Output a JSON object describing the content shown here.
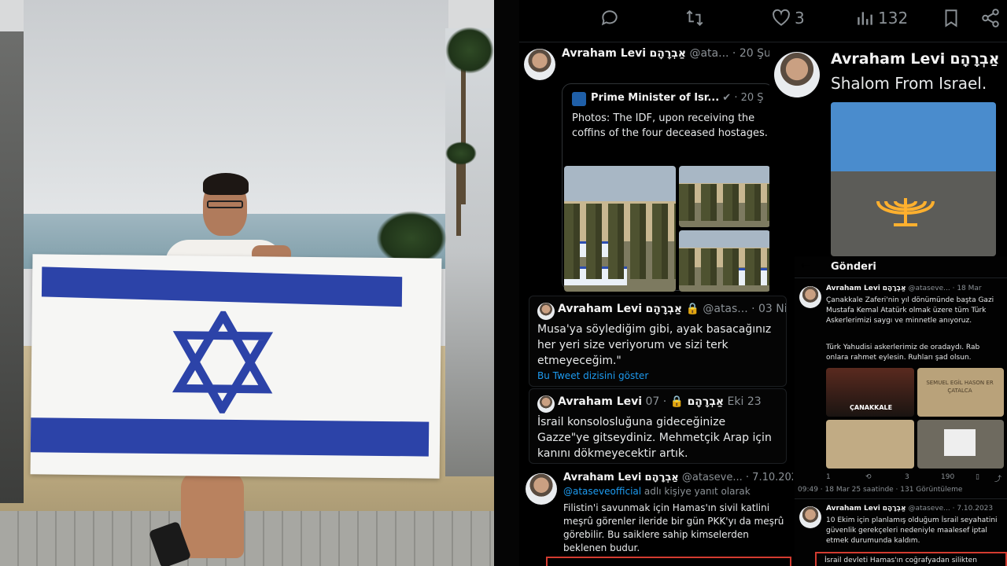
{
  "actions": {
    "replies": "",
    "retweets": "",
    "likes": "3",
    "views": "132"
  },
  "left_tweet": {
    "name": "Avraham Levi",
    "hebrew": "אַבְרָהָם",
    "handle": "@ata...",
    "date": "· 20 Şu",
    "emoji": "😔😔",
    "quote": {
      "name": "Prime Minister of Isr...",
      "date": "· 20 Ş",
      "text": "Photos: The IDF, upon receiving the coffins of the four deceased hostages."
    }
  },
  "right_top": {
    "name": "Avraham Levi",
    "hebrew": "אַבְרָהָם",
    "text": "Shalom From Israel."
  },
  "tweet2": {
    "name": "Avraham Levi",
    "hebrew": "אַבְרָהָם",
    "handle": "@atas...",
    "date": "· 03 Nis",
    "text": "Musa'ya söylediğim gibi, ayak basacağınız her yeri size veriyorum ve sizi terk etmeyeceğim.\"",
    "link": "Bu Tweet dizisini göster"
  },
  "tweet3": {
    "name": "Avraham Levi",
    "hebrew": "אַבְרָהָם",
    "date": "· 07 Eki 23",
    "text": "İsrail konsolosluğuna gideceğinize Gazze\"ye gitseydiniz. Mehmetçik Arap için kanını dökmeyecektir artık."
  },
  "tweet4": {
    "name": "Avraham Levi",
    "hebrew": "אַבְרָהָם",
    "handle": "@ataseve...",
    "date": "· 7.10.2023",
    "reply_handle": "@ataseveofficial",
    "reply_suffix": "adlı kişiye yanıt olarak",
    "text": "Filistin'i savunmak için Hamas'ın sivil katlini meşrû görenler ileride bir gün PKK'yı da meşrû görebilir. Bu saiklere sahip kimselerden beklenen budur."
  },
  "gonderi": {
    "back": "←",
    "title": "Gönderi",
    "name": "Avraham Levi",
    "hebrew": "אַבְרָהָם",
    "handle": "@ataseve...",
    "date": "· 18 Mar",
    "text1": "Çanakkale Zaferi'nin yıl dönümünde başta Gazi Mustafa Kemal Atatürk olmak üzere tüm Türk Askerlerimizi saygı ve minnetle anıyoruz.",
    "text2": "Türk Yahudisi askerlerimiz de oradaydı. Rab onlara rahmet eylesin. Ruhları şad olsun.",
    "img_label": "ÇANAKKALE",
    "plaque1": "SEMUEL EGİL HASON ER ÇATALCA",
    "plaque2": "",
    "stats": {
      "replies": "1",
      "likes": "3",
      "views": "190"
    },
    "meta": "09:49 · 18 Mar 25 saatinde · 131 Görüntüleme"
  },
  "gonderi2": {
    "name": "Avraham Levi",
    "hebrew": "אַבְרָהָם",
    "handle": "@ataseve...",
    "date": "· 7.10.2023",
    "text": "10 Ekim için planlamış olduğum İsrail seyahatini güvenlik gerekçeleri nedeniyle maalesef iptal etmek durumunda kaldım.",
    "cut": "İsrail devleti Hamas'ın coğrafyadan silikten"
  },
  "colors": {
    "bg": "#000000",
    "text": "#e7e9ea",
    "muted": "#8b9196",
    "link": "#1d9bf0",
    "flag_blue": "#2c43a8",
    "highlight": "#d43b30"
  }
}
